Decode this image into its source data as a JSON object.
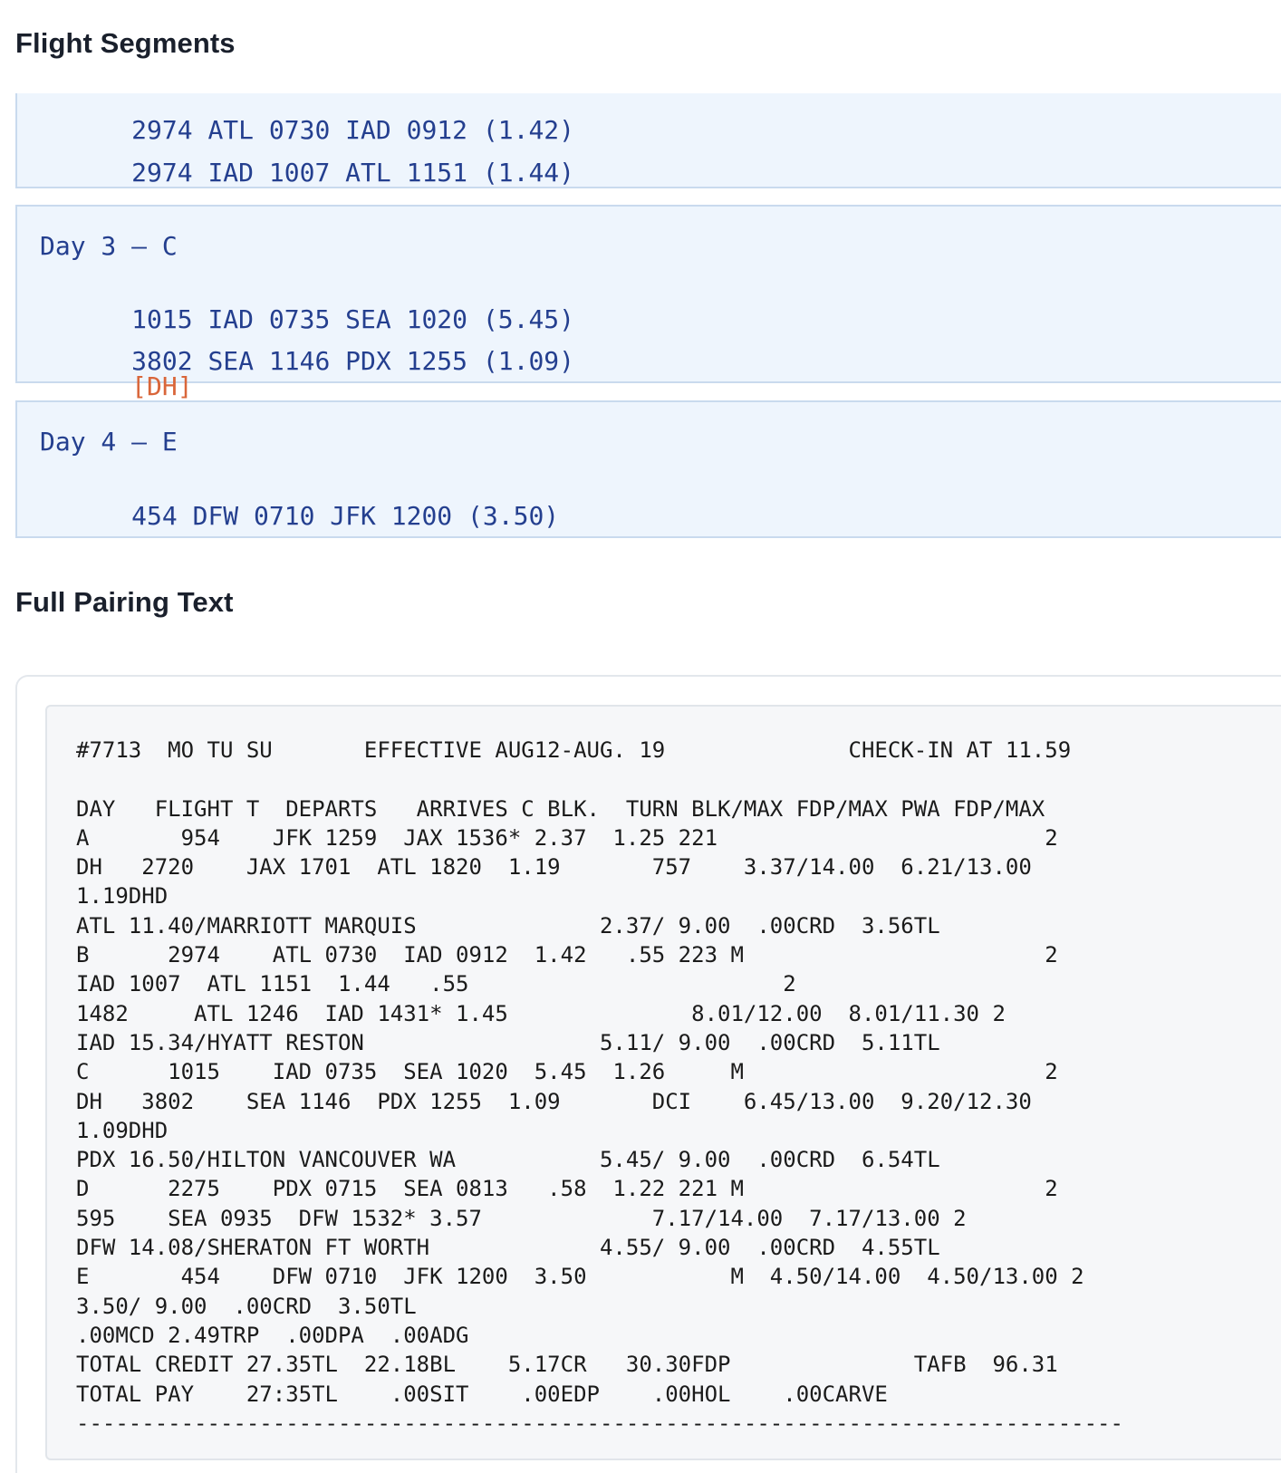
{
  "segments_section": {
    "title": "Flight Segments",
    "days": [
      {
        "header": "",
        "lines": [
          {
            "text": "2974 ATL 0730 IAD 0912 (1.42)",
            "tag": ""
          },
          {
            "text": "2974 IAD 1007 ATL 1151 (1.44)",
            "tag": ""
          }
        ]
      },
      {
        "header": "Day 3 – C",
        "lines": [
          {
            "text": "1015 IAD 0735 SEA 1020 (5.45)",
            "tag": ""
          },
          {
            "text": "3802 SEA 1146 PDX 1255 (1.09)",
            "tag": "[DH]"
          }
        ]
      },
      {
        "header": "Day 4 – E",
        "lines": [
          {
            "text": "454 DFW 0710 JFK 1200 (3.50)",
            "tag": ""
          }
        ]
      }
    ]
  },
  "pairing_section": {
    "title": "Full Pairing Text",
    "text": "#7713  MO TU SU       EFFECTIVE AUG12-AUG. 19              CHECK-IN AT 11.59\n\nDAY   FLIGHT T  DEPARTS   ARRIVES C BLK.  TURN BLK/MAX FDP/MAX PWA FDP/MAX\nA       954    JFK 1259  JAX 1536* 2.37  1.25 221                         2\nDH   2720    JAX 1701  ATL 1820  1.19       757    3.37/14.00  6.21/13.00\n1.19DHD\nATL 11.40/MARRIOTT MARQUIS              2.37/ 9.00  .00CRD  3.56TL\nB      2974    ATL 0730  IAD 0912  1.42   .55 223 M                       2\nIAD 1007  ATL 1151  1.44   .55                        2\n1482     ATL 1246  IAD 1431* 1.45              8.01/12.00  8.01/11.30 2\nIAD 15.34/HYATT RESTON                  5.11/ 9.00  .00CRD  5.11TL\nC      1015    IAD 0735  SEA 1020  5.45  1.26     M                       2\nDH   3802    SEA 1146  PDX 1255  1.09       DCI    6.45/13.00  9.20/12.30\n1.09DHD\nPDX 16.50/HILTON VANCOUVER WA           5.45/ 9.00  .00CRD  6.54TL\nD      2275    PDX 0715  SEA 0813   .58  1.22 221 M                       2\n595    SEA 0935  DFW 1532* 3.57             7.17/14.00  7.17/13.00 2\nDFW 14.08/SHERATON FT WORTH             4.55/ 9.00  .00CRD  4.55TL\nE       454    DFW 0710  JFK 1200  3.50           M  4.50/14.00  4.50/13.00 2\n3.50/ 9.00  .00CRD  3.50TL\n.00MCD 2.49TRP  .00DPA  .00ADG\nTOTAL CREDIT 27.35TL  22.18BL    5.17CR   30.30FDP              TAFB  96.31\nTOTAL PAY    27:35TL    .00SIT    .00EDP    .00HOL    .00CARVE\n--------------------------------------------------------------------------------"
  }
}
